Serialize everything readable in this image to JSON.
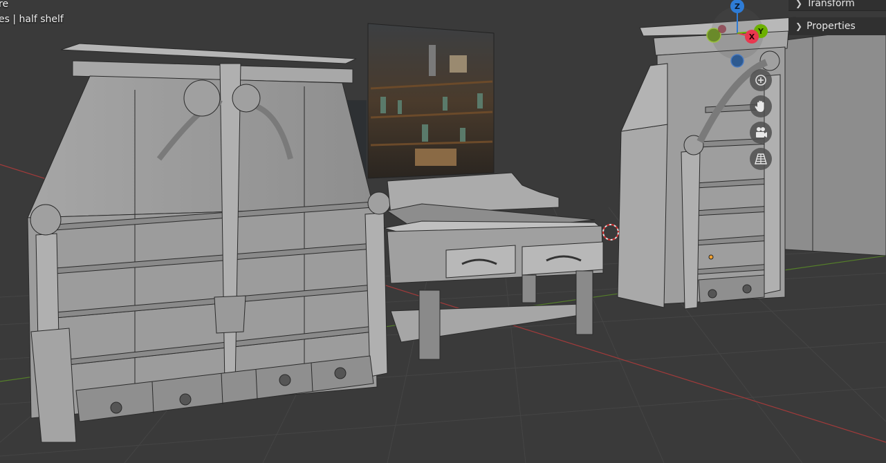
{
  "hud": {
    "line1": "re",
    "line2": "es | half shelf"
  },
  "sidebar_panels": {
    "transform_label": "Transform",
    "properties_label": "Properties"
  },
  "gizmo": {
    "z_label": "Z",
    "y_label": "Y",
    "x_label": "X",
    "x_color": "#e8384f",
    "y_color": "#6cb000",
    "z_color": "#2e7cd6"
  },
  "nav_buttons": [
    "zoom-icon",
    "pan-hand-icon",
    "camera-icon",
    "perspective-grid-icon"
  ],
  "colors": {
    "viewport_bg": "#3a3a3a",
    "grid_line": "#444444",
    "x_axis": "#b03a3a",
    "y_axis": "#5a8a2a",
    "model_face": "#9a9a9a",
    "model_edge": "#2a2a2a"
  }
}
